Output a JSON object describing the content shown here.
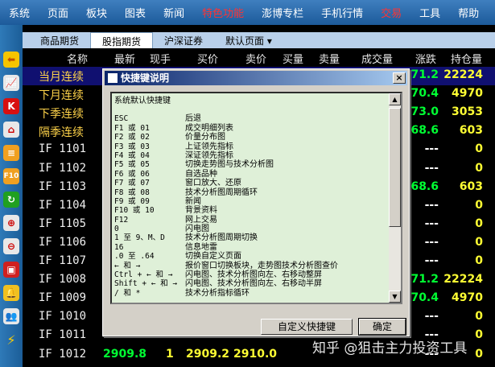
{
  "menu": [
    "系统",
    "页面",
    "板块",
    "图表",
    "新闻",
    "特色功能",
    "澎博专栏",
    "手机行情",
    "交易",
    "工具",
    "帮助"
  ],
  "tabs": [
    "商品期货",
    "股指期货",
    "沪深证券",
    "默认页面 ▾"
  ],
  "columns": [
    "名称",
    "最新",
    "现手",
    "买价",
    "卖价",
    "买量",
    "卖量",
    "成交量",
    "涨跌",
    "持仓量"
  ],
  "rows": [
    {
      "name": "当月连续",
      "chg": "-71.2",
      "pos": "22224"
    },
    {
      "name": "下月连续",
      "chg": "-70.4",
      "pos": "4970"
    },
    {
      "name": "下季连续",
      "chg": "-73.0",
      "pos": "3053"
    },
    {
      "name": "隔季连续",
      "chg": "-68.6",
      "pos": "603"
    },
    {
      "name": "IF  1101",
      "chg": "---",
      "pos": "0"
    },
    {
      "name": "IF  1102",
      "chg": "---",
      "pos": "0"
    },
    {
      "name": "IF  1103",
      "chg": "-68.6",
      "pos": "603"
    },
    {
      "name": "IF  1104",
      "chg": "---",
      "pos": "0"
    },
    {
      "name": "IF  1105",
      "chg": "---",
      "pos": "0"
    },
    {
      "name": "IF  1106",
      "chg": "---",
      "pos": "0"
    },
    {
      "name": "IF  1107",
      "chg": "---",
      "pos": "0"
    },
    {
      "name": "IF  1008",
      "chg": "-71.2",
      "pos": "22224"
    },
    {
      "name": "IF  1009",
      "chg": "-70.4",
      "pos": "4970"
    },
    {
      "name": "IF  1010",
      "chg": "---",
      "pos": "0"
    },
    {
      "name": "IF  1011",
      "chg": "---",
      "pos": "0"
    },
    {
      "name": "IF  1012",
      "latest": "2909.8",
      "hand": "1",
      "bid": "2909.2",
      "ask": "2910.0",
      "chg": "---",
      "pos": "0"
    }
  ],
  "dialog": {
    "title": "快捷键说明",
    "close": "×",
    "heading": "系统默认快捷键",
    "shortcuts": [
      {
        "key": "ESC",
        "desc": "后退"
      },
      {
        "key": "F1 或 01",
        "desc": "成交明细列表"
      },
      {
        "key": "F2 或 02",
        "desc": "价量分布图"
      },
      {
        "key": "F3 或 03",
        "desc": "上证领先指标"
      },
      {
        "key": "F4 或 04",
        "desc": "深证领先指标"
      },
      {
        "key": "F5 或 05",
        "desc": "切换走势图与技术分析图"
      },
      {
        "key": "F6 或 06",
        "desc": "自选品种"
      },
      {
        "key": "F7 或 07",
        "desc": "窗口放大、还原"
      },
      {
        "key": "F8 或 08",
        "desc": "技术分析图周期循环"
      },
      {
        "key": "F9 或 09",
        "desc": "新闻"
      },
      {
        "key": "F10 或 10",
        "desc": "背景资料"
      },
      {
        "key": "F12",
        "desc": "网上交易"
      },
      {
        "key": "0",
        "desc": "闪电图"
      },
      {
        "key": "1 至 9、M、D",
        "desc": "技术分析图周期切换"
      },
      {
        "key": "16",
        "desc": "信息地雷"
      },
      {
        "key": ".0 至 .64",
        "desc": "切换自定义页面"
      },
      {
        "key": "← 和 →",
        "desc": "报价窗口切换板块，走势图技术分析图查价"
      },
      {
        "key": "Ctrl + ← 和 →",
        "desc": "闪电图、技术分析图向左、右移动整屏"
      },
      {
        "key": "Shift + ← 和 →",
        "desc": "闪电图、技术分析图向左、右移动半屏"
      },
      {
        "key": "/ 和 *",
        "desc": "技术分析指标循环"
      }
    ],
    "btn_custom": "自定义快捷键",
    "btn_ok": "确定"
  },
  "watermark": "知乎 @狙击主力投资工具"
}
